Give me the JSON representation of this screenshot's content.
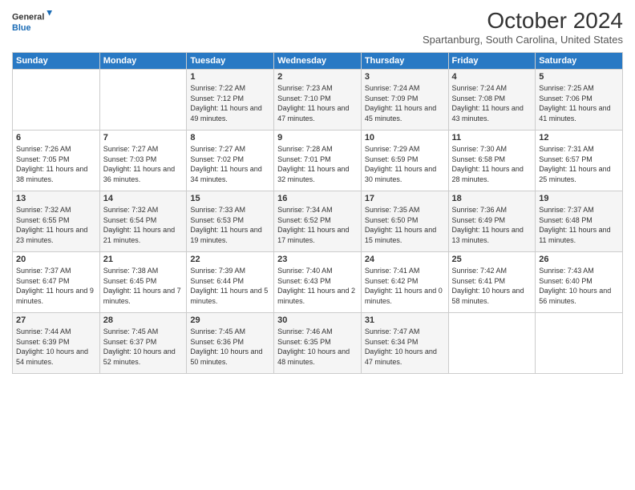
{
  "logo": {
    "line1": "General",
    "line2": "Blue"
  },
  "title": "October 2024",
  "location": "Spartanburg, South Carolina, United States",
  "days_header": [
    "Sunday",
    "Monday",
    "Tuesday",
    "Wednesday",
    "Thursday",
    "Friday",
    "Saturday"
  ],
  "weeks": [
    [
      {
        "day": "",
        "sunrise": "",
        "sunset": "",
        "daylight": ""
      },
      {
        "day": "",
        "sunrise": "",
        "sunset": "",
        "daylight": ""
      },
      {
        "day": "1",
        "sunrise": "Sunrise: 7:22 AM",
        "sunset": "Sunset: 7:12 PM",
        "daylight": "Daylight: 11 hours and 49 minutes."
      },
      {
        "day": "2",
        "sunrise": "Sunrise: 7:23 AM",
        "sunset": "Sunset: 7:10 PM",
        "daylight": "Daylight: 11 hours and 47 minutes."
      },
      {
        "day": "3",
        "sunrise": "Sunrise: 7:24 AM",
        "sunset": "Sunset: 7:09 PM",
        "daylight": "Daylight: 11 hours and 45 minutes."
      },
      {
        "day": "4",
        "sunrise": "Sunrise: 7:24 AM",
        "sunset": "Sunset: 7:08 PM",
        "daylight": "Daylight: 11 hours and 43 minutes."
      },
      {
        "day": "5",
        "sunrise": "Sunrise: 7:25 AM",
        "sunset": "Sunset: 7:06 PM",
        "daylight": "Daylight: 11 hours and 41 minutes."
      }
    ],
    [
      {
        "day": "6",
        "sunrise": "Sunrise: 7:26 AM",
        "sunset": "Sunset: 7:05 PM",
        "daylight": "Daylight: 11 hours and 38 minutes."
      },
      {
        "day": "7",
        "sunrise": "Sunrise: 7:27 AM",
        "sunset": "Sunset: 7:03 PM",
        "daylight": "Daylight: 11 hours and 36 minutes."
      },
      {
        "day": "8",
        "sunrise": "Sunrise: 7:27 AM",
        "sunset": "Sunset: 7:02 PM",
        "daylight": "Daylight: 11 hours and 34 minutes."
      },
      {
        "day": "9",
        "sunrise": "Sunrise: 7:28 AM",
        "sunset": "Sunset: 7:01 PM",
        "daylight": "Daylight: 11 hours and 32 minutes."
      },
      {
        "day": "10",
        "sunrise": "Sunrise: 7:29 AM",
        "sunset": "Sunset: 6:59 PM",
        "daylight": "Daylight: 11 hours and 30 minutes."
      },
      {
        "day": "11",
        "sunrise": "Sunrise: 7:30 AM",
        "sunset": "Sunset: 6:58 PM",
        "daylight": "Daylight: 11 hours and 28 minutes."
      },
      {
        "day": "12",
        "sunrise": "Sunrise: 7:31 AM",
        "sunset": "Sunset: 6:57 PM",
        "daylight": "Daylight: 11 hours and 25 minutes."
      }
    ],
    [
      {
        "day": "13",
        "sunrise": "Sunrise: 7:32 AM",
        "sunset": "Sunset: 6:55 PM",
        "daylight": "Daylight: 11 hours and 23 minutes."
      },
      {
        "day": "14",
        "sunrise": "Sunrise: 7:32 AM",
        "sunset": "Sunset: 6:54 PM",
        "daylight": "Daylight: 11 hours and 21 minutes."
      },
      {
        "day": "15",
        "sunrise": "Sunrise: 7:33 AM",
        "sunset": "Sunset: 6:53 PM",
        "daylight": "Daylight: 11 hours and 19 minutes."
      },
      {
        "day": "16",
        "sunrise": "Sunrise: 7:34 AM",
        "sunset": "Sunset: 6:52 PM",
        "daylight": "Daylight: 11 hours and 17 minutes."
      },
      {
        "day": "17",
        "sunrise": "Sunrise: 7:35 AM",
        "sunset": "Sunset: 6:50 PM",
        "daylight": "Daylight: 11 hours and 15 minutes."
      },
      {
        "day": "18",
        "sunrise": "Sunrise: 7:36 AM",
        "sunset": "Sunset: 6:49 PM",
        "daylight": "Daylight: 11 hours and 13 minutes."
      },
      {
        "day": "19",
        "sunrise": "Sunrise: 7:37 AM",
        "sunset": "Sunset: 6:48 PM",
        "daylight": "Daylight: 11 hours and 11 minutes."
      }
    ],
    [
      {
        "day": "20",
        "sunrise": "Sunrise: 7:37 AM",
        "sunset": "Sunset: 6:47 PM",
        "daylight": "Daylight: 11 hours and 9 minutes."
      },
      {
        "day": "21",
        "sunrise": "Sunrise: 7:38 AM",
        "sunset": "Sunset: 6:45 PM",
        "daylight": "Daylight: 11 hours and 7 minutes."
      },
      {
        "day": "22",
        "sunrise": "Sunrise: 7:39 AM",
        "sunset": "Sunset: 6:44 PM",
        "daylight": "Daylight: 11 hours and 5 minutes."
      },
      {
        "day": "23",
        "sunrise": "Sunrise: 7:40 AM",
        "sunset": "Sunset: 6:43 PM",
        "daylight": "Daylight: 11 hours and 2 minutes."
      },
      {
        "day": "24",
        "sunrise": "Sunrise: 7:41 AM",
        "sunset": "Sunset: 6:42 PM",
        "daylight": "Daylight: 11 hours and 0 minutes."
      },
      {
        "day": "25",
        "sunrise": "Sunrise: 7:42 AM",
        "sunset": "Sunset: 6:41 PM",
        "daylight": "Daylight: 10 hours and 58 minutes."
      },
      {
        "day": "26",
        "sunrise": "Sunrise: 7:43 AM",
        "sunset": "Sunset: 6:40 PM",
        "daylight": "Daylight: 10 hours and 56 minutes."
      }
    ],
    [
      {
        "day": "27",
        "sunrise": "Sunrise: 7:44 AM",
        "sunset": "Sunset: 6:39 PM",
        "daylight": "Daylight: 10 hours and 54 minutes."
      },
      {
        "day": "28",
        "sunrise": "Sunrise: 7:45 AM",
        "sunset": "Sunset: 6:37 PM",
        "daylight": "Daylight: 10 hours and 52 minutes."
      },
      {
        "day": "29",
        "sunrise": "Sunrise: 7:45 AM",
        "sunset": "Sunset: 6:36 PM",
        "daylight": "Daylight: 10 hours and 50 minutes."
      },
      {
        "day": "30",
        "sunrise": "Sunrise: 7:46 AM",
        "sunset": "Sunset: 6:35 PM",
        "daylight": "Daylight: 10 hours and 48 minutes."
      },
      {
        "day": "31",
        "sunrise": "Sunrise: 7:47 AM",
        "sunset": "Sunset: 6:34 PM",
        "daylight": "Daylight: 10 hours and 47 minutes."
      },
      {
        "day": "",
        "sunrise": "",
        "sunset": "",
        "daylight": ""
      },
      {
        "day": "",
        "sunrise": "",
        "sunset": "",
        "daylight": ""
      }
    ]
  ]
}
